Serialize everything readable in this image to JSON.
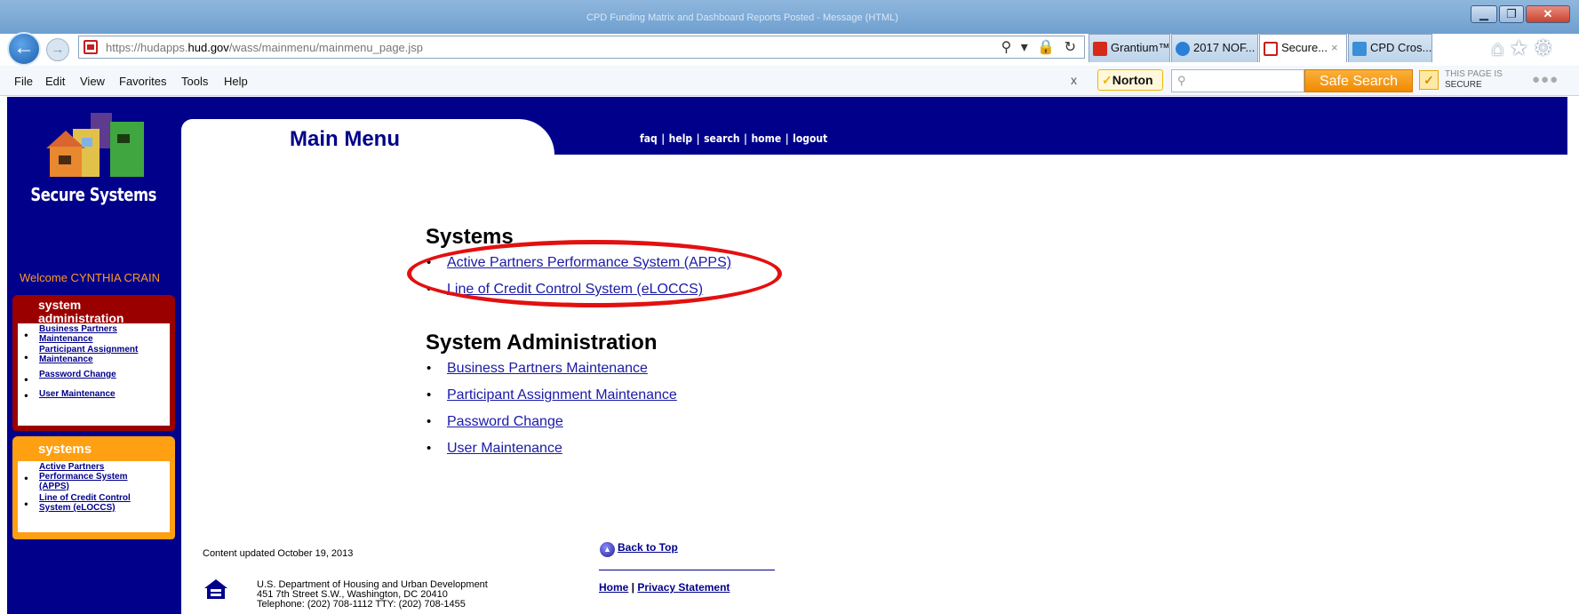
{
  "browser": {
    "window_title": "CPD Funding Matrix and Dashboard Reports Posted - Message (HTML)",
    "url_prefix": "https://hudapps.",
    "url_domain": "hud.gov",
    "url_path": "/wass/mainmenu/mainmenu_page.jsp",
    "address_tools": "⚲ ▾ 🔒 ↻",
    "tabs": [
      {
        "label": "Grantium™",
        "icon_color": "#d62a1a"
      },
      {
        "label": "2017 NOF...",
        "icon_color": "#2a7fd6"
      },
      {
        "label": "Secure...",
        "icon_color": "#c81e1e"
      },
      {
        "label": "CPD Cros...",
        "icon_color": "#3a8fd6"
      }
    ],
    "tab_close": "×",
    "toolbar_icons": "⌂★⚙",
    "menu": [
      "File",
      "Edit",
      "View",
      "Favorites",
      "Tools",
      "Help"
    ],
    "norton_close": "x",
    "norton_label": "Norton",
    "norton_check": "✓",
    "search_icon": "⚲",
    "safe_search": "Safe Search",
    "secure_line1": "THIS PAGE IS",
    "secure_line2": "SECURE",
    "more": "●●●"
  },
  "site": {
    "logo_text": "Secure Systems",
    "page_title": "Main Menu",
    "top_nav": [
      "faq",
      "help",
      "search",
      "home",
      "logout"
    ],
    "welcome": "Welcome CYNTHIA CRAIN",
    "sidebar_admin": {
      "title": "system administration",
      "items": [
        "Business Partners Maintenance",
        "Participant Assignment Maintenance",
        "Password Change",
        "User Maintenance"
      ]
    },
    "sidebar_systems": {
      "title": "systems",
      "items": [
        "Active Partners Performance System (APPS)",
        "Line of Credit Control System (eLOCCS)"
      ]
    }
  },
  "main": {
    "systems_heading": "Systems",
    "systems_links": [
      "Active Partners Performance System (APPS)",
      "Line of Credit Control System (eLOCCS)"
    ],
    "admin_heading": "System Administration",
    "admin_links": [
      "Business Partners Maintenance",
      "Participant Assignment Maintenance",
      "Password Change",
      "User Maintenance"
    ]
  },
  "footer": {
    "updated": "Content updated October 19, 2013",
    "back_to_top": "Back to Top",
    "home": "Home",
    "privacy": "Privacy Statement",
    "address_line1": "U.S. Department of Housing and Urban Development",
    "address_line2": "451 7th Street S.W., Washington, DC 20410",
    "address_line3": "Telephone: (202) 708-1112 TTY: (202) 708-1455"
  },
  "colors": {
    "hud_blue": "#00008b",
    "sidebar_admin": "#9b0000",
    "sidebar_systems": "#ff9f12",
    "welcome": "#ff9a1f",
    "annotation_oval": "#e31010"
  }
}
